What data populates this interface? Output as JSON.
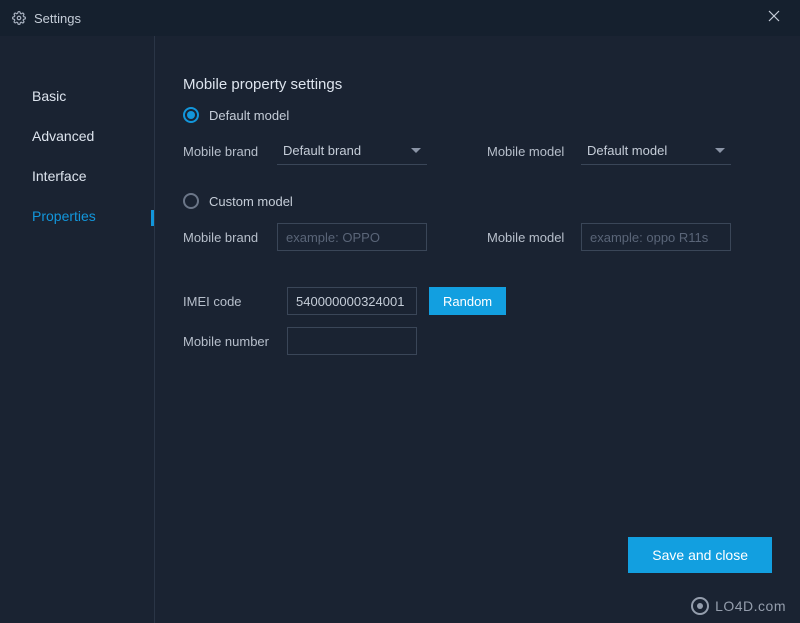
{
  "titlebar": {
    "title": "Settings"
  },
  "sidebar": {
    "items": [
      {
        "label": "Basic"
      },
      {
        "label": "Advanced"
      },
      {
        "label": "Interface"
      },
      {
        "label": "Properties"
      }
    ],
    "active_index": 3
  },
  "content": {
    "section_title": "Mobile property settings",
    "default_model": {
      "radio_label": "Default model",
      "brand_label": "Mobile brand",
      "brand_value": "Default brand",
      "model_label": "Mobile model",
      "model_value": "Default model"
    },
    "custom_model": {
      "radio_label": "Custom model",
      "brand_label": "Mobile brand",
      "brand_placeholder": "example: OPPO",
      "brand_value": "",
      "model_label": "Mobile model",
      "model_placeholder": "example: oppo R11s",
      "model_value": ""
    },
    "imei": {
      "label": "IMEI code",
      "value": "540000000324001",
      "random_button": "Random"
    },
    "mobile_number": {
      "label": "Mobile number",
      "value": ""
    },
    "save_button": "Save and close"
  },
  "watermark": "LO4D.com"
}
